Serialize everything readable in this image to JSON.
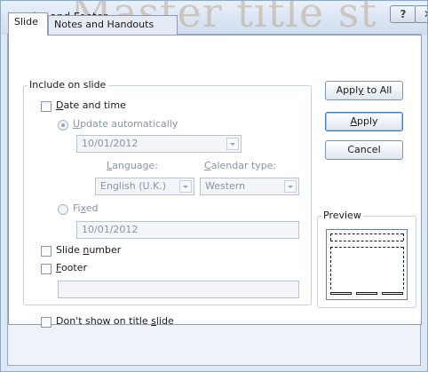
{
  "window": {
    "title": "Header and Footer",
    "background_watermark": "Master title st",
    "help_glyph": "?",
    "close_glyph": "✕"
  },
  "tabs": [
    {
      "label": "Slide",
      "active": true
    },
    {
      "label": "Notes and Handouts",
      "active": false
    }
  ],
  "include": {
    "legend": "Include on slide",
    "date_time": {
      "pre": "",
      "key": "D",
      "post": "ate and time",
      "checked": false
    },
    "update_auto": {
      "pre": "",
      "key": "U",
      "post": "pdate automatically",
      "selected": true
    },
    "date_value": "10/01/2012",
    "language": {
      "label_pre": "",
      "label_key": "L",
      "label_post": "anguage:",
      "value": "English (U.K.)"
    },
    "calendar": {
      "label_pre": "",
      "label_key": "C",
      "label_post": "alendar type:",
      "value": "Western"
    },
    "fixed": {
      "pre": "Fi",
      "key": "x",
      "post": "ed",
      "selected": false,
      "value": "10/01/2012"
    },
    "slide_number": {
      "pre": "Slide ",
      "key": "n",
      "post": "umber",
      "checked": false
    },
    "footer": {
      "pre": "",
      "key": "F",
      "post": "ooter",
      "checked": false,
      "value": ""
    }
  },
  "dont_show": {
    "pre": "Don't show on title ",
    "key": "s",
    "post": "lide",
    "checked": false
  },
  "buttons": {
    "apply_all": {
      "pre": "Appl",
      "key": "y",
      "post": " to All"
    },
    "apply": {
      "pre": "",
      "key": "A",
      "post": "pply"
    },
    "cancel": {
      "label": "Cancel"
    }
  },
  "preview": {
    "legend": "Preview"
  }
}
